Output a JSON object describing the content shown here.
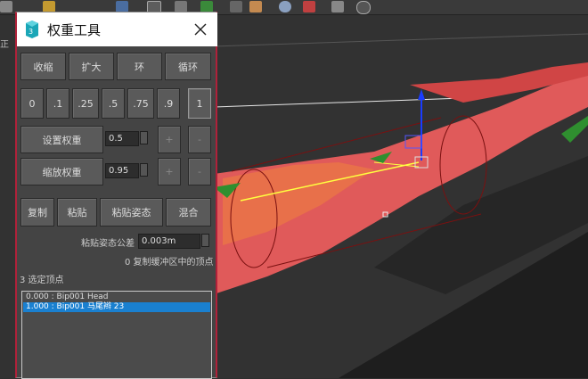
{
  "app": {
    "logo": "3ds-max-logo"
  },
  "viewport": {
    "label": "正"
  },
  "dialog": {
    "title": "权重工具",
    "row1": [
      "收缩",
      "扩大",
      "环",
      "循环"
    ],
    "presets": [
      "0",
      ".1",
      ".25",
      ".5",
      ".75",
      ".9",
      "1"
    ],
    "set_weight": {
      "label": "设置权重",
      "value": "0.5",
      "plus": "+",
      "minus": "-"
    },
    "scale_weight": {
      "label": "缩放权重",
      "value": "0.95",
      "plus": "+",
      "minus": "-"
    },
    "row4": {
      "copy": "复制",
      "paste": "粘贴",
      "paste_pos": "粘贴姿态",
      "blend": "混合"
    },
    "tolerance": {
      "label": "粘贴姿态公差",
      "value": "0.003m"
    },
    "buffer_status": "0 复制缓冲区中的顶点",
    "selected_status": "3 选定顶点",
    "vertex_list": [
      {
        "text": "0.000 : Bip001 Head",
        "selected": false
      },
      {
        "text": "1.000 : Bip001 马尾辫 23",
        "selected": true
      }
    ]
  },
  "colors": {
    "accent": "#b0213a",
    "selection": "#1a80d0",
    "mesh": "#e05a5a"
  }
}
